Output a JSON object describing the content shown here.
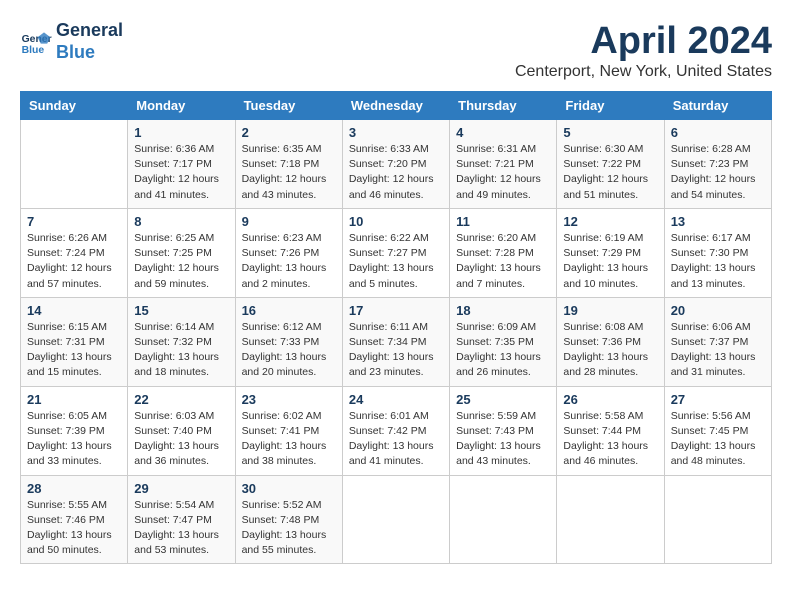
{
  "logo": {
    "line1": "General",
    "line2": "Blue"
  },
  "title": "April 2024",
  "location": "Centerport, New York, United States",
  "weekdays": [
    "Sunday",
    "Monday",
    "Tuesday",
    "Wednesday",
    "Thursday",
    "Friday",
    "Saturday"
  ],
  "weeks": [
    [
      {
        "day": "",
        "info": ""
      },
      {
        "day": "1",
        "info": "Sunrise: 6:36 AM\nSunset: 7:17 PM\nDaylight: 12 hours\nand 41 minutes."
      },
      {
        "day": "2",
        "info": "Sunrise: 6:35 AM\nSunset: 7:18 PM\nDaylight: 12 hours\nand 43 minutes."
      },
      {
        "day": "3",
        "info": "Sunrise: 6:33 AM\nSunset: 7:20 PM\nDaylight: 12 hours\nand 46 minutes."
      },
      {
        "day": "4",
        "info": "Sunrise: 6:31 AM\nSunset: 7:21 PM\nDaylight: 12 hours\nand 49 minutes."
      },
      {
        "day": "5",
        "info": "Sunrise: 6:30 AM\nSunset: 7:22 PM\nDaylight: 12 hours\nand 51 minutes."
      },
      {
        "day": "6",
        "info": "Sunrise: 6:28 AM\nSunset: 7:23 PM\nDaylight: 12 hours\nand 54 minutes."
      }
    ],
    [
      {
        "day": "7",
        "info": "Sunrise: 6:26 AM\nSunset: 7:24 PM\nDaylight: 12 hours\nand 57 minutes."
      },
      {
        "day": "8",
        "info": "Sunrise: 6:25 AM\nSunset: 7:25 PM\nDaylight: 12 hours\nand 59 minutes."
      },
      {
        "day": "9",
        "info": "Sunrise: 6:23 AM\nSunset: 7:26 PM\nDaylight: 13 hours\nand 2 minutes."
      },
      {
        "day": "10",
        "info": "Sunrise: 6:22 AM\nSunset: 7:27 PM\nDaylight: 13 hours\nand 5 minutes."
      },
      {
        "day": "11",
        "info": "Sunrise: 6:20 AM\nSunset: 7:28 PM\nDaylight: 13 hours\nand 7 minutes."
      },
      {
        "day": "12",
        "info": "Sunrise: 6:19 AM\nSunset: 7:29 PM\nDaylight: 13 hours\nand 10 minutes."
      },
      {
        "day": "13",
        "info": "Sunrise: 6:17 AM\nSunset: 7:30 PM\nDaylight: 13 hours\nand 13 minutes."
      }
    ],
    [
      {
        "day": "14",
        "info": "Sunrise: 6:15 AM\nSunset: 7:31 PM\nDaylight: 13 hours\nand 15 minutes."
      },
      {
        "day": "15",
        "info": "Sunrise: 6:14 AM\nSunset: 7:32 PM\nDaylight: 13 hours\nand 18 minutes."
      },
      {
        "day": "16",
        "info": "Sunrise: 6:12 AM\nSunset: 7:33 PM\nDaylight: 13 hours\nand 20 minutes."
      },
      {
        "day": "17",
        "info": "Sunrise: 6:11 AM\nSunset: 7:34 PM\nDaylight: 13 hours\nand 23 minutes."
      },
      {
        "day": "18",
        "info": "Sunrise: 6:09 AM\nSunset: 7:35 PM\nDaylight: 13 hours\nand 26 minutes."
      },
      {
        "day": "19",
        "info": "Sunrise: 6:08 AM\nSunset: 7:36 PM\nDaylight: 13 hours\nand 28 minutes."
      },
      {
        "day": "20",
        "info": "Sunrise: 6:06 AM\nSunset: 7:37 PM\nDaylight: 13 hours\nand 31 minutes."
      }
    ],
    [
      {
        "day": "21",
        "info": "Sunrise: 6:05 AM\nSunset: 7:39 PM\nDaylight: 13 hours\nand 33 minutes."
      },
      {
        "day": "22",
        "info": "Sunrise: 6:03 AM\nSunset: 7:40 PM\nDaylight: 13 hours\nand 36 minutes."
      },
      {
        "day": "23",
        "info": "Sunrise: 6:02 AM\nSunset: 7:41 PM\nDaylight: 13 hours\nand 38 minutes."
      },
      {
        "day": "24",
        "info": "Sunrise: 6:01 AM\nSunset: 7:42 PM\nDaylight: 13 hours\nand 41 minutes."
      },
      {
        "day": "25",
        "info": "Sunrise: 5:59 AM\nSunset: 7:43 PM\nDaylight: 13 hours\nand 43 minutes."
      },
      {
        "day": "26",
        "info": "Sunrise: 5:58 AM\nSunset: 7:44 PM\nDaylight: 13 hours\nand 46 minutes."
      },
      {
        "day": "27",
        "info": "Sunrise: 5:56 AM\nSunset: 7:45 PM\nDaylight: 13 hours\nand 48 minutes."
      }
    ],
    [
      {
        "day": "28",
        "info": "Sunrise: 5:55 AM\nSunset: 7:46 PM\nDaylight: 13 hours\nand 50 minutes."
      },
      {
        "day": "29",
        "info": "Sunrise: 5:54 AM\nSunset: 7:47 PM\nDaylight: 13 hours\nand 53 minutes."
      },
      {
        "day": "30",
        "info": "Sunrise: 5:52 AM\nSunset: 7:48 PM\nDaylight: 13 hours\nand 55 minutes."
      },
      {
        "day": "",
        "info": ""
      },
      {
        "day": "",
        "info": ""
      },
      {
        "day": "",
        "info": ""
      },
      {
        "day": "",
        "info": ""
      }
    ]
  ]
}
